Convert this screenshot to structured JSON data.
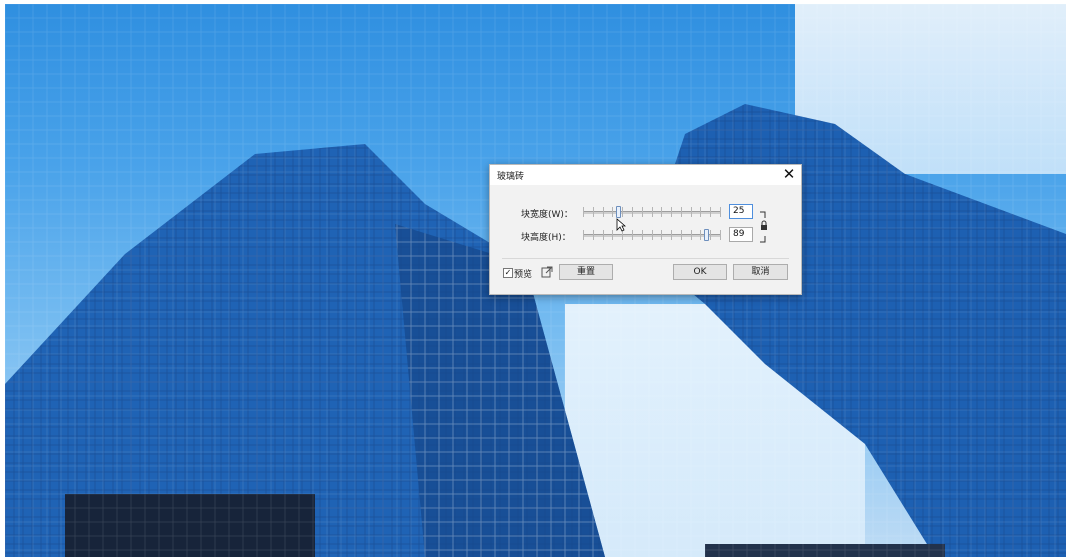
{
  "dialog": {
    "title": "玻璃砖",
    "close_icon": "close-icon",
    "block_width": {
      "label": "块宽度(W)：",
      "value": "25",
      "level_fraction": 0.25
    },
    "block_height": {
      "label": "块高度(H)：",
      "value": "89",
      "level_fraction": 0.89
    },
    "lock_icon": "lock-icon",
    "preview": {
      "label": "预览",
      "checked": true,
      "check_glyph": "✓"
    },
    "popout_icon": "popout-icon",
    "reset_label": "重置",
    "ok_label": "OK",
    "cancel_label": "取消"
  },
  "colors": {
    "sky": "#2f8fe0",
    "glass": "#1f63b5",
    "accent": "#4f8fdd"
  }
}
